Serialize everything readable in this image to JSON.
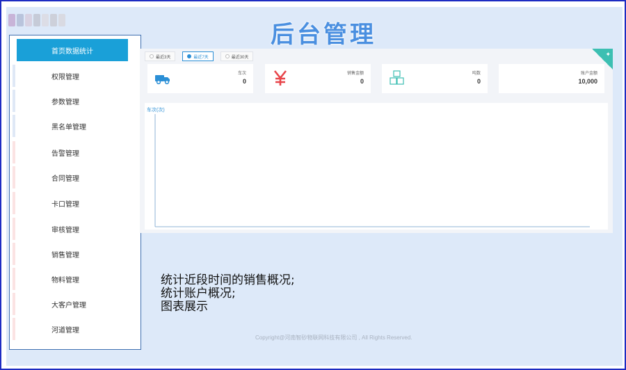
{
  "header": {
    "title": "后台管理"
  },
  "sidebar": {
    "items": [
      {
        "label": "首页数据统计",
        "active": true,
        "stripe": ""
      },
      {
        "label": "权限管理",
        "active": false,
        "stripe": "#dfe8f6"
      },
      {
        "label": "参数管理",
        "active": false,
        "stripe": "#dfe8f6"
      },
      {
        "label": "黑名单管理",
        "active": false,
        "stripe": "#dfe8f6"
      },
      {
        "label": "告警管理",
        "active": false,
        "stripe": "#fbe3e3"
      },
      {
        "label": "合同管理",
        "active": false,
        "stripe": "#fbe3e3"
      },
      {
        "label": "卡口管理",
        "active": false,
        "stripe": "#fbe3e3"
      },
      {
        "label": "审核管理",
        "active": false,
        "stripe": "#fbe3e3"
      },
      {
        "label": "销售管理",
        "active": false,
        "stripe": "#fbe3e3"
      },
      {
        "label": "物料管理",
        "active": false,
        "stripe": "#fbe3e3"
      },
      {
        "label": "大客户管理",
        "active": false,
        "stripe": "#fbe3e3"
      },
      {
        "label": "河道管理",
        "active": false,
        "stripe": "#fbe3e3"
      }
    ]
  },
  "range": {
    "options": [
      "最近3天",
      "最近7天",
      "最近30天"
    ],
    "selected": "最近7天"
  },
  "stats": [
    {
      "label": "车次",
      "value": "0",
      "icon": "truck-icon",
      "color": "#2b8fd6"
    },
    {
      "label": "销售金额",
      "value": "0",
      "icon": "yen-icon",
      "color": "#e8454a"
    },
    {
      "label": "吨数",
      "value": "0",
      "icon": "boxes-icon",
      "color": "#3cbfb2"
    },
    {
      "label": "账户金额",
      "value": "10,000",
      "icon": "account-icon",
      "color": "#2b8fd6"
    }
  ],
  "chart_data": {
    "type": "bar",
    "ylabel": "车次(次)",
    "categories": [],
    "values": []
  },
  "description": {
    "lines": [
      "统计近段时间的销售概况;",
      "统计账户概况;",
      "图表展示"
    ]
  },
  "footer": {
    "copyright": "Copyright@河南智砂物联网科技有限公司 , All Rights Reserved."
  },
  "colors": {
    "accent": "#1aa0d8",
    "title": "#4a8fe0",
    "background": "#dde9f9"
  }
}
